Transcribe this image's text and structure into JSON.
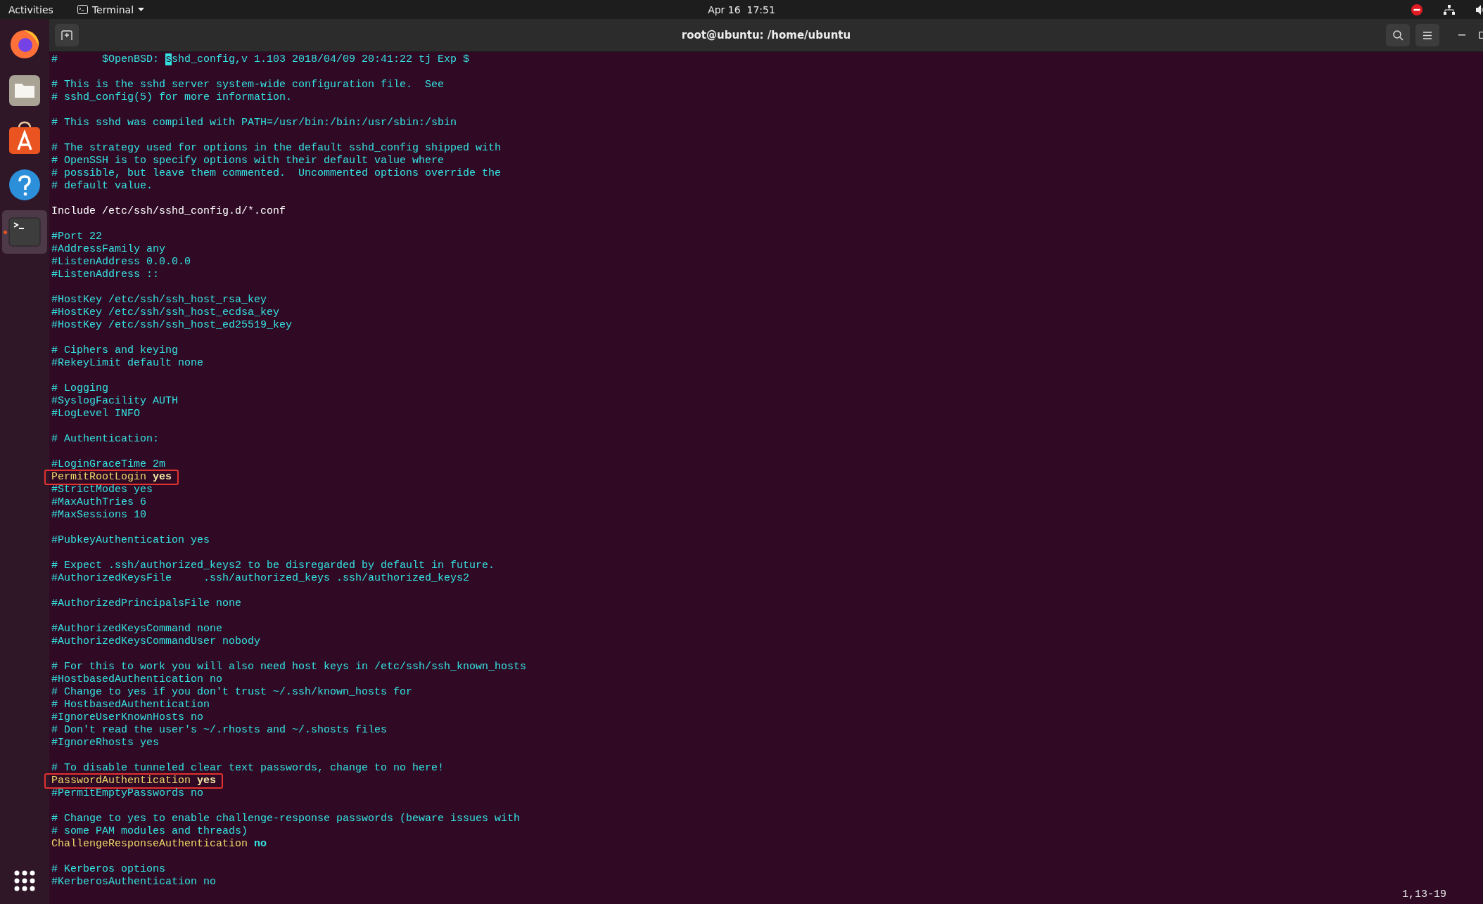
{
  "top_bar": {
    "activities": "Activities",
    "app_menu": "Terminal",
    "clock": "Apr 16  17:51"
  },
  "window": {
    "title": "root@ubuntu: /home/ubuntu"
  },
  "dock": {
    "items": [
      {
        "kind": "firefox",
        "running": false
      },
      {
        "kind": "files",
        "running": false
      },
      {
        "kind": "software",
        "running": false
      },
      {
        "kind": "help",
        "running": false
      },
      {
        "kind": "terminal",
        "running": true
      }
    ]
  },
  "lines": [
    {
      "kind": "cursor",
      "before": "#       $OpenBSD: ",
      "cursor": "s",
      "after": "shd_config,v 1.103 2018/04/09 20:41:22 tj Exp $"
    },
    {
      "kind": "blank"
    },
    {
      "kind": "comment",
      "text": "# This is the sshd server system-wide configuration file.  See"
    },
    {
      "kind": "comment",
      "text": "# sshd_config(5) for more information."
    },
    {
      "kind": "blank"
    },
    {
      "kind": "comment",
      "text": "# This sshd was compiled with PATH=/usr/bin:/bin:/usr/sbin:/sbin"
    },
    {
      "kind": "blank"
    },
    {
      "kind": "comment",
      "text": "# The strategy used for options in the default sshd_config shipped with"
    },
    {
      "kind": "comment",
      "text": "# OpenSSH is to specify options with their default value where"
    },
    {
      "kind": "comment",
      "text": "# possible, but leave them commented.  Uncommented options override the"
    },
    {
      "kind": "comment",
      "text": "# default value."
    },
    {
      "kind": "blank"
    },
    {
      "kind": "plain",
      "text": "Include /etc/ssh/sshd_config.d/*.conf"
    },
    {
      "kind": "blank"
    },
    {
      "kind": "comment",
      "text": "#Port 22"
    },
    {
      "kind": "comment",
      "text": "#AddressFamily any"
    },
    {
      "kind": "comment",
      "text": "#ListenAddress 0.0.0.0"
    },
    {
      "kind": "comment",
      "text": "#ListenAddress ::"
    },
    {
      "kind": "blank"
    },
    {
      "kind": "comment",
      "text": "#HostKey /etc/ssh/ssh_host_rsa_key"
    },
    {
      "kind": "comment",
      "text": "#HostKey /etc/ssh/ssh_host_ecdsa_key"
    },
    {
      "kind": "comment",
      "text": "#HostKey /etc/ssh/ssh_host_ed25519_key"
    },
    {
      "kind": "blank"
    },
    {
      "kind": "comment",
      "text": "# Ciphers and keying"
    },
    {
      "kind": "comment",
      "text": "#RekeyLimit default none"
    },
    {
      "kind": "blank"
    },
    {
      "kind": "comment",
      "text": "# Logging"
    },
    {
      "kind": "comment",
      "text": "#SyslogFacility AUTH"
    },
    {
      "kind": "comment",
      "text": "#LogLevel INFO"
    },
    {
      "kind": "blank"
    },
    {
      "kind": "comment",
      "text": "# Authentication:"
    },
    {
      "kind": "blank"
    },
    {
      "kind": "comment",
      "text": "#LoginGraceTime 2m"
    },
    {
      "kind": "directive",
      "key": "PermitRootLogin",
      "value": {
        "text": "yes",
        "color": "#f3e7a6"
      },
      "boxed": true
    },
    {
      "kind": "comment",
      "text": "#StrictModes yes"
    },
    {
      "kind": "comment",
      "text": "#MaxAuthTries 6"
    },
    {
      "kind": "comment",
      "text": "#MaxSessions 10"
    },
    {
      "kind": "blank"
    },
    {
      "kind": "comment",
      "text": "#PubkeyAuthentication yes"
    },
    {
      "kind": "blank"
    },
    {
      "kind": "comment",
      "text": "# Expect .ssh/authorized_keys2 to be disregarded by default in future."
    },
    {
      "kind": "comment",
      "text": "#AuthorizedKeysFile     .ssh/authorized_keys .ssh/authorized_keys2"
    },
    {
      "kind": "blank"
    },
    {
      "kind": "comment",
      "text": "#AuthorizedPrincipalsFile none"
    },
    {
      "kind": "blank"
    },
    {
      "kind": "comment",
      "text": "#AuthorizedKeysCommand none"
    },
    {
      "kind": "comment",
      "text": "#AuthorizedKeysCommandUser nobody"
    },
    {
      "kind": "blank"
    },
    {
      "kind": "comment",
      "text": "# For this to work you will also need host keys in /etc/ssh/ssh_known_hosts"
    },
    {
      "kind": "comment",
      "text": "#HostbasedAuthentication no"
    },
    {
      "kind": "comment",
      "text": "# Change to yes if you don't trust ~/.ssh/known_hosts for"
    },
    {
      "kind": "comment",
      "text": "# HostbasedAuthentication"
    },
    {
      "kind": "comment",
      "text": "#IgnoreUserKnownHosts no"
    },
    {
      "kind": "comment",
      "text": "# Don't read the user's ~/.rhosts and ~/.shosts files"
    },
    {
      "kind": "comment",
      "text": "#IgnoreRhosts yes"
    },
    {
      "kind": "blank"
    },
    {
      "kind": "comment",
      "text": "# To disable tunneled clear text passwords, change to no here!"
    },
    {
      "kind": "directive",
      "key": "PasswordAuthentication",
      "value": {
        "text": "yes",
        "color": "#f3e7a6"
      },
      "boxed": true
    },
    {
      "kind": "comment",
      "text": "#PermitEmptyPasswords no"
    },
    {
      "kind": "blank"
    },
    {
      "kind": "comment",
      "text": "# Change to yes to enable challenge-response passwords (beware issues with"
    },
    {
      "kind": "comment",
      "text": "# some PAM modules and threads)"
    },
    {
      "kind": "directive",
      "key": "ChallengeResponseAuthentication",
      "value": {
        "text": "no",
        "color": "#34e2e2"
      },
      "boxed": false
    },
    {
      "kind": "blank"
    },
    {
      "kind": "comment",
      "text": "# Kerberos options"
    },
    {
      "kind": "comment",
      "text": "#KerberosAuthentication no"
    }
  ],
  "ruler": "1,13-19"
}
